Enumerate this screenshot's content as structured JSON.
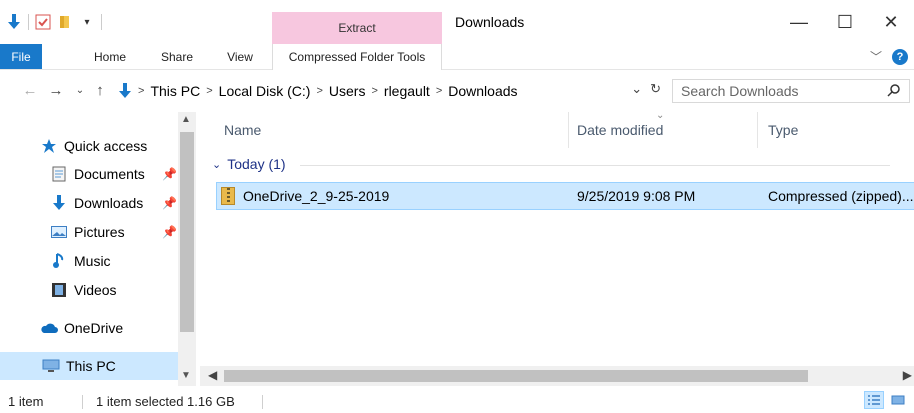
{
  "window": {
    "title": "Downloads",
    "contextual_tab_header": "Extract",
    "controls": {
      "minimize": "—",
      "maximize": "☐",
      "close": "✕"
    }
  },
  "ribbon": {
    "tabs": [
      {
        "label": "File"
      },
      {
        "label": "Home"
      },
      {
        "label": "Share"
      },
      {
        "label": "View"
      },
      {
        "label": "Compressed Folder Tools"
      }
    ],
    "help": "?"
  },
  "address": {
    "crumbs": [
      "This PC",
      "Local Disk (C:)",
      "Users",
      "rlegault",
      "Downloads"
    ],
    "search_placeholder": "Search Downloads"
  },
  "nav": {
    "items": [
      {
        "label": "Quick access",
        "icon": "star-icon"
      },
      {
        "label": "Documents",
        "icon": "documents-icon",
        "pinned": true
      },
      {
        "label": "Downloads",
        "icon": "download-arrow-icon",
        "pinned": true
      },
      {
        "label": "Pictures",
        "icon": "pictures-icon",
        "pinned": true
      },
      {
        "label": "Music",
        "icon": "music-note-icon"
      },
      {
        "label": "Videos",
        "icon": "film-icon"
      },
      {
        "label": "OneDrive",
        "icon": "cloud-icon"
      },
      {
        "label": "This PC",
        "icon": "computer-icon",
        "selected": true
      }
    ]
  },
  "columns": {
    "name": "Name",
    "date": "Date modified",
    "type": "Type"
  },
  "group": {
    "label": "Today (1)"
  },
  "files": [
    {
      "name": "OneDrive_2_9-25-2019",
      "date": "9/25/2019 9:08 PM",
      "type": "Compressed (zipped)..."
    }
  ],
  "status": {
    "count": "1 item",
    "selection": "1 item selected  1.16 GB"
  },
  "colors": {
    "accent": "#1979ca",
    "selection": "#cce8ff",
    "context_tab": "#f7c7df"
  }
}
